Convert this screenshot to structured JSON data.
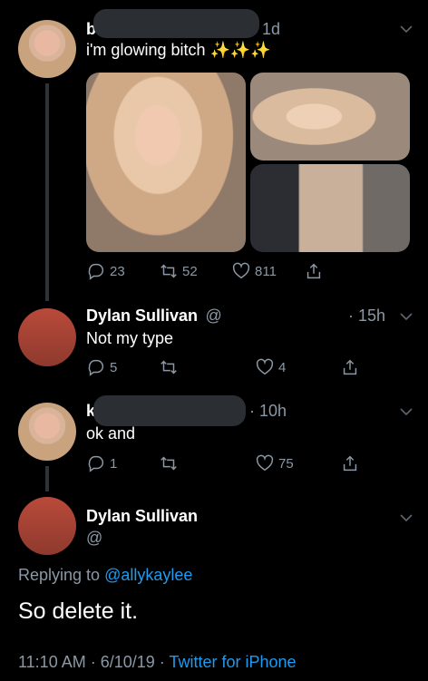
{
  "tweet1": {
    "name_initial": "b",
    "time": "1d",
    "text": "i'm glowing bitch ✨✨✨",
    "reply_count": "23",
    "retweet_count": "52",
    "like_count": "811"
  },
  "reply1": {
    "name": "Dylan Sullivan",
    "handle": "@",
    "time": "· 15h",
    "text": "Not my type",
    "reply_count": "5",
    "retweet_count": "",
    "like_count": "4"
  },
  "tweet2": {
    "name_initial": "k",
    "time": "· 10h",
    "text": "ok and",
    "reply_count": "1",
    "retweet_count": "",
    "like_count": "75"
  },
  "main": {
    "name": "Dylan Sullivan",
    "handle": "@",
    "replying_prefix": "Replying to ",
    "replying_handle": "@allykaylee",
    "text": "So delete it.",
    "timestamp": "11:10 AM · 6/10/19 · ",
    "source": "Twitter for iPhone"
  },
  "colors": {
    "background": "#000000",
    "link": "#1d9bf0",
    "muted": "#8b98a5"
  }
}
